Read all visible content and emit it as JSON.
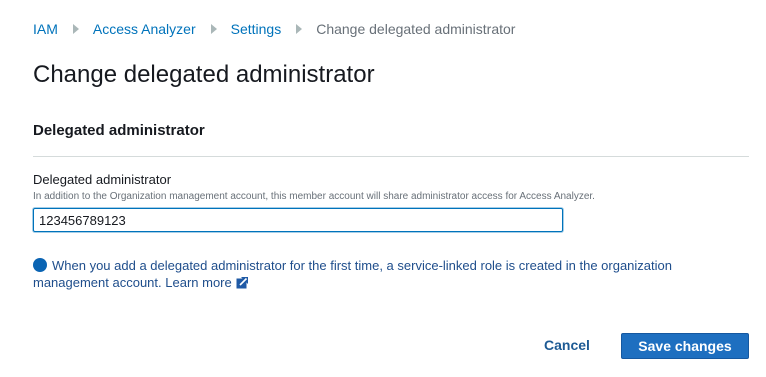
{
  "breadcrumb": {
    "items": [
      {
        "label": "IAM"
      },
      {
        "label": "Access Analyzer"
      },
      {
        "label": "Settings"
      },
      {
        "label": "Change delegated administrator"
      }
    ]
  },
  "page": {
    "title": "Change delegated administrator"
  },
  "section": {
    "title": "Delegated administrator",
    "field": {
      "label": "Delegated administrator",
      "description": "In addition to the Organization management account, this member account will share administrator access for Access Analyzer.",
      "value": "123456789123",
      "placeholder": ""
    },
    "info": {
      "icon": "info-circle-icon",
      "text": "When you add a delegated administrator for the first time, a service-linked role is created in the organization management account.",
      "link_label": "Learn more",
      "link_icon": "external-link-icon"
    }
  },
  "actions": {
    "cancel_label": "Cancel",
    "save_label": "Save changes"
  },
  "colors": {
    "link": "#0073bb",
    "primary_button": "#1e6fc0",
    "info": "#0a64b3",
    "divider": "#d5dbdb"
  }
}
